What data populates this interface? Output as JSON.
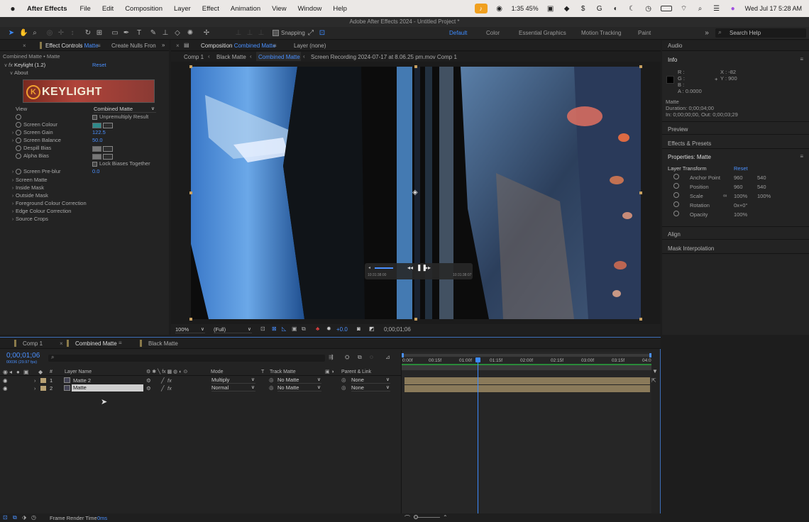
{
  "menubar": {
    "app": "After Effects",
    "items": [
      "File",
      "Edit",
      "Composition",
      "Layer",
      "Effect",
      "Animation",
      "View",
      "Window",
      "Help"
    ],
    "battery": "1:35 45%",
    "datetime": "Wed Jul 17  5:28 AM"
  },
  "window_title": "Adobe After Effects 2024 - Untitled Project *",
  "toolbar": {
    "snapping": "Snapping",
    "workspaces": [
      "Default",
      "Color",
      "Essential Graphics",
      "Motion Tracking",
      "Paint"
    ],
    "search_placeholder": "Search Help"
  },
  "effect_controls": {
    "tab_prefix": "Effect Controls",
    "tab_layer": "Matte",
    "tab2": "Create Nulls Fron",
    "breadcrumb": "Combined Matte • Matte",
    "effect_name": "Keylight (1.2)",
    "reset": "Reset",
    "about": "About",
    "logo_text": "KEYLIGHT",
    "view_label": "View",
    "view_value": "Combined Matte",
    "unpremultiply": "Unpremultiply Result",
    "screen_colour": "Screen Colour",
    "screen_gain": "Screen Gain",
    "screen_gain_value": "122.5",
    "screen_balance": "Screen Balance",
    "screen_balance_value": "50.0",
    "despill_bias": "Despill Bias",
    "alpha_bias": "Alpha Bias",
    "lock_biases": "Lock Biases Together",
    "screen_preblur": "Screen Pre-blur",
    "screen_preblur_value": "0.0",
    "groups": [
      "Screen Matte",
      "Inside Mask",
      "Outside Mask",
      "Foreground Colour Correction",
      "Edge Colour Correction",
      "Source Crops"
    ],
    "screen_colour_hex": "#2f8a8a"
  },
  "composition": {
    "tab_prefix": "Composition",
    "tab_name": "Combined Matte",
    "layer_tab": "Layer (none)",
    "breadcrumbs": [
      "Comp 1",
      "Black Matte",
      "Combined Matte",
      "Screen Recording 2024-07-17 at 8.06.25 pm.mov Comp 1"
    ],
    "zoom": "100%",
    "resolution": "(Full)",
    "exposure": "+0.0",
    "timecode": "0;00;01;06",
    "player_time_left": "10:31:38:00",
    "player_time_right": "10:31:38:07"
  },
  "right_panel": {
    "audio": "Audio",
    "info": "Info",
    "r": "R :",
    "g": "G :",
    "b": "B :",
    "a": "A : 0.0000",
    "x": "X : -82",
    "y": "Y : 900",
    "layer_name": "Matte",
    "duration": "Duration: 0;00;04;00",
    "inout": "In: 0;00;00;00, Out: 0;00;03;29",
    "preview": "Preview",
    "effects_presets": "Effects & Presets",
    "properties": "Properties: Matte",
    "layer_transform": "Layer Transform",
    "reset": "Reset",
    "anchor_point": "Anchor Point",
    "anchor_x": "960",
    "anchor_y": "540",
    "position": "Position",
    "position_x": "960",
    "position_y": "540",
    "scale": "Scale",
    "scale_x": "100%",
    "scale_y": "100%",
    "rotation": "Rotation",
    "rotation_value": "0x+0°",
    "opacity": "Opacity",
    "opacity_value": "100%",
    "align": "Align",
    "mask_interpolation": "Mask Interpolation"
  },
  "timeline": {
    "tabs": [
      "Comp 1",
      "Combined Matte",
      "Black Matte"
    ],
    "timecode": "0;00;01;06",
    "fps": "00036 (29.97 fps)",
    "columns": {
      "layer_name": "Layer Name",
      "mode": "Mode",
      "t": "T",
      "track_matte": "Track Matte",
      "parent": "Parent & Link",
      "num": "#"
    },
    "ruler": [
      "0:00f",
      "00:15f",
      "01:00f",
      "01:15f",
      "02:00f",
      "02:15f",
      "03:00f",
      "03:15f",
      "04:0"
    ],
    "layers": [
      {
        "num": "1",
        "name": "Matte 2",
        "mode": "Multiply",
        "matte": "No Matte",
        "parent": "None"
      },
      {
        "num": "2",
        "name": "Matte",
        "mode": "Normal",
        "matte": "No Matte",
        "parent": "None"
      }
    ],
    "render_time_label": "Frame Render Time",
    "render_time_value": "0ms"
  }
}
